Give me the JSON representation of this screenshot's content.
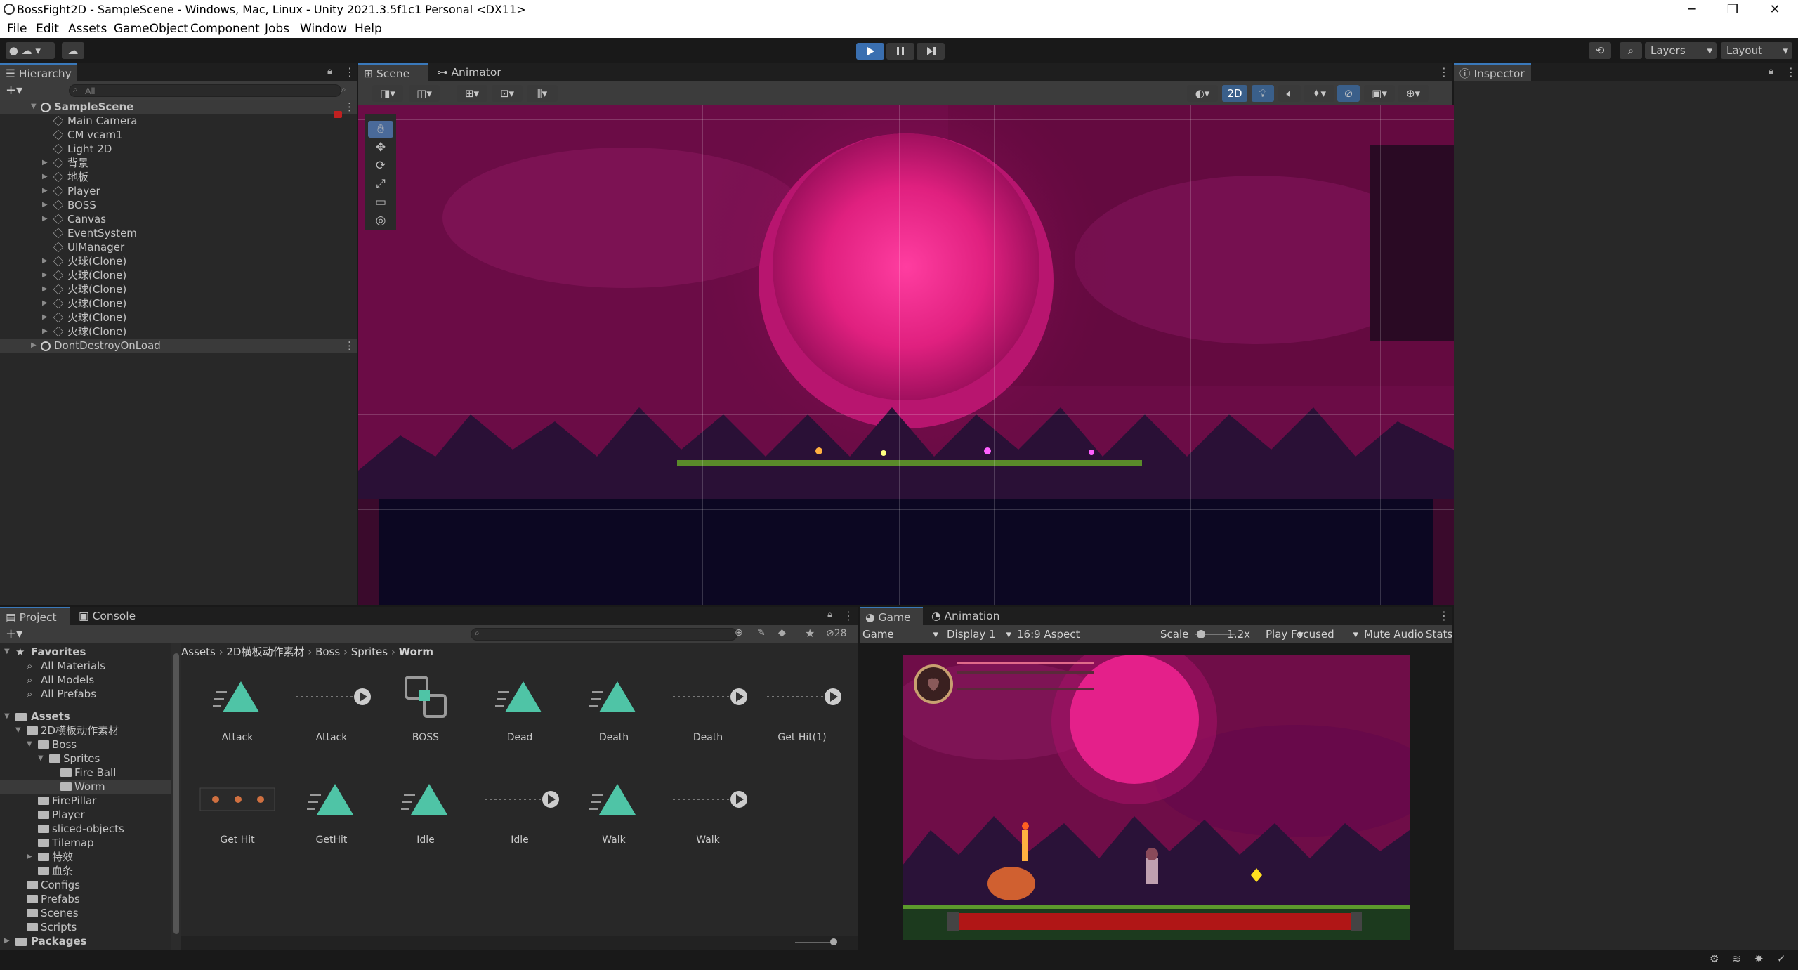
{
  "titlebar": {
    "title": "BossFight2D - SampleScene - Windows, Mac, Linux - Unity 2021.3.5f1c1 Personal <DX11>"
  },
  "menu": [
    "File",
    "Edit",
    "Assets",
    "GameObject",
    "Component",
    "Jobs",
    "Window",
    "Help"
  ],
  "toolbar": {
    "layers": "Layers",
    "layout": "Layout"
  },
  "hierarchy": {
    "tab": "Hierarchy",
    "search_placeholder": "All",
    "scene": "SampleScene",
    "items": [
      {
        "label": "Main Camera",
        "expand": false
      },
      {
        "label": "CM vcam1",
        "expand": false
      },
      {
        "label": "Light 2D",
        "expand": false
      },
      {
        "label": "背景",
        "expand": true
      },
      {
        "label": "地板",
        "expand": true
      },
      {
        "label": "Player",
        "expand": true
      },
      {
        "label": "BOSS",
        "expand": true
      },
      {
        "label": "Canvas",
        "expand": true
      },
      {
        "label": "EventSystem",
        "expand": false
      },
      {
        "label": "UIManager",
        "expand": false
      },
      {
        "label": "火球(Clone)",
        "expand": true
      },
      {
        "label": "火球(Clone)",
        "expand": true
      },
      {
        "label": "火球(Clone)",
        "expand": true
      },
      {
        "label": "火球(Clone)",
        "expand": true
      },
      {
        "label": "火球(Clone)",
        "expand": true
      },
      {
        "label": "火球(Clone)",
        "expand": true
      }
    ],
    "dont_destroy": "DontDestroyOnLoad"
  },
  "scene_view": {
    "tabs": [
      "Scene",
      "Animator"
    ],
    "mode_2d": "2D"
  },
  "inspector": {
    "tab": "Inspector"
  },
  "project": {
    "tabs": [
      "Project",
      "Console"
    ],
    "hidden_count": "28",
    "breadcrumb": [
      "Assets",
      "2D横板动作素材",
      "Boss",
      "Sprites",
      "Worm"
    ],
    "favorites": {
      "label": "Favorites",
      "items": [
        "All Materials",
        "All Models",
        "All Prefabs"
      ]
    },
    "assets_label": "Assets",
    "tree": [
      {
        "label": "2D横板动作素材",
        "indent": 1
      },
      {
        "label": "Boss",
        "indent": 2
      },
      {
        "label": "Sprites",
        "indent": 3
      },
      {
        "label": "Fire Ball",
        "indent": 4
      },
      {
        "label": "Worm",
        "indent": 4
      },
      {
        "label": "FirePillar",
        "indent": 2
      },
      {
        "label": "Player",
        "indent": 2
      },
      {
        "label": "sliced-objects",
        "indent": 2
      },
      {
        "label": "Tilemap",
        "indent": 2
      },
      {
        "label": "特效",
        "indent": 2
      },
      {
        "label": "血条",
        "indent": 2
      },
      {
        "label": "Configs",
        "indent": 1
      },
      {
        "label": "Prefabs",
        "indent": 1
      },
      {
        "label": "Scenes",
        "indent": 1
      },
      {
        "label": "Scripts",
        "indent": 1
      }
    ],
    "packages_label": "Packages",
    "assets": [
      {
        "label": "Attack",
        "kind": "clip"
      },
      {
        "label": "Attack",
        "kind": "anim"
      },
      {
        "label": "BOSS",
        "kind": "controller"
      },
      {
        "label": "Dead",
        "kind": "clip"
      },
      {
        "label": "Death",
        "kind": "clip"
      },
      {
        "label": "Death",
        "kind": "anim"
      },
      {
        "label": "Get Hit(1)",
        "kind": "anim"
      },
      {
        "label": "Get Hit",
        "kind": "sprite"
      },
      {
        "label": "GetHit",
        "kind": "clip"
      },
      {
        "label": "Idle",
        "kind": "clip"
      },
      {
        "label": "Idle",
        "kind": "anim"
      },
      {
        "label": "Walk",
        "kind": "clip"
      },
      {
        "label": "Walk",
        "kind": "anim"
      }
    ]
  },
  "game_view": {
    "tabs": [
      "Game",
      "Animation"
    ],
    "mode": "Game",
    "display": "Display 1",
    "aspect": "16:9 Aspect",
    "scale_label": "Scale",
    "scale_value": "1.2x",
    "play_focused": "Play Focused",
    "mute": "Mute Audio",
    "stats": "Stats"
  },
  "colors": {
    "accent": "#3a79bb",
    "sky": "#7a0e55",
    "moon": "#e81e8c",
    "teal": "#4fc4a6"
  }
}
